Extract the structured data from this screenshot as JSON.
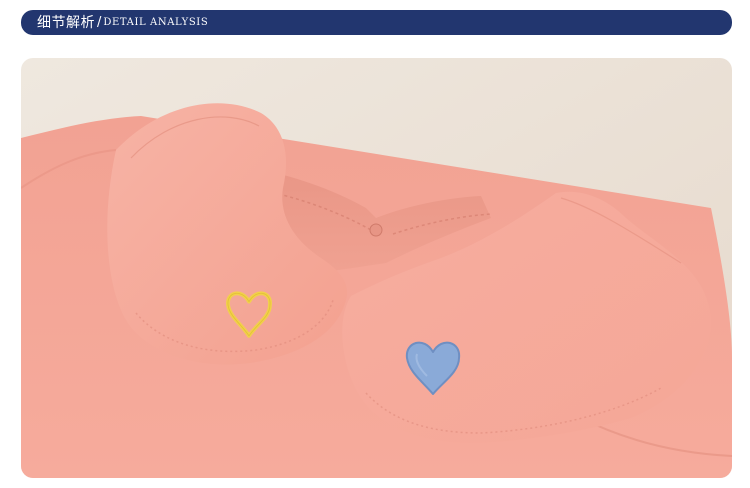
{
  "header": {
    "title": "细节解析",
    "separator": "/",
    "subtitle": "DETAIL ANALYSIS",
    "background_color": "#22366f",
    "text_color": "#ffffff"
  },
  "photo": {
    "subject": "peter-pan-collar-detail",
    "garment_color": "#f4a699",
    "background_color": "#efe6dc",
    "left_heart_color": "#f2d14a",
    "right_heart_color": "#8aaad8"
  }
}
